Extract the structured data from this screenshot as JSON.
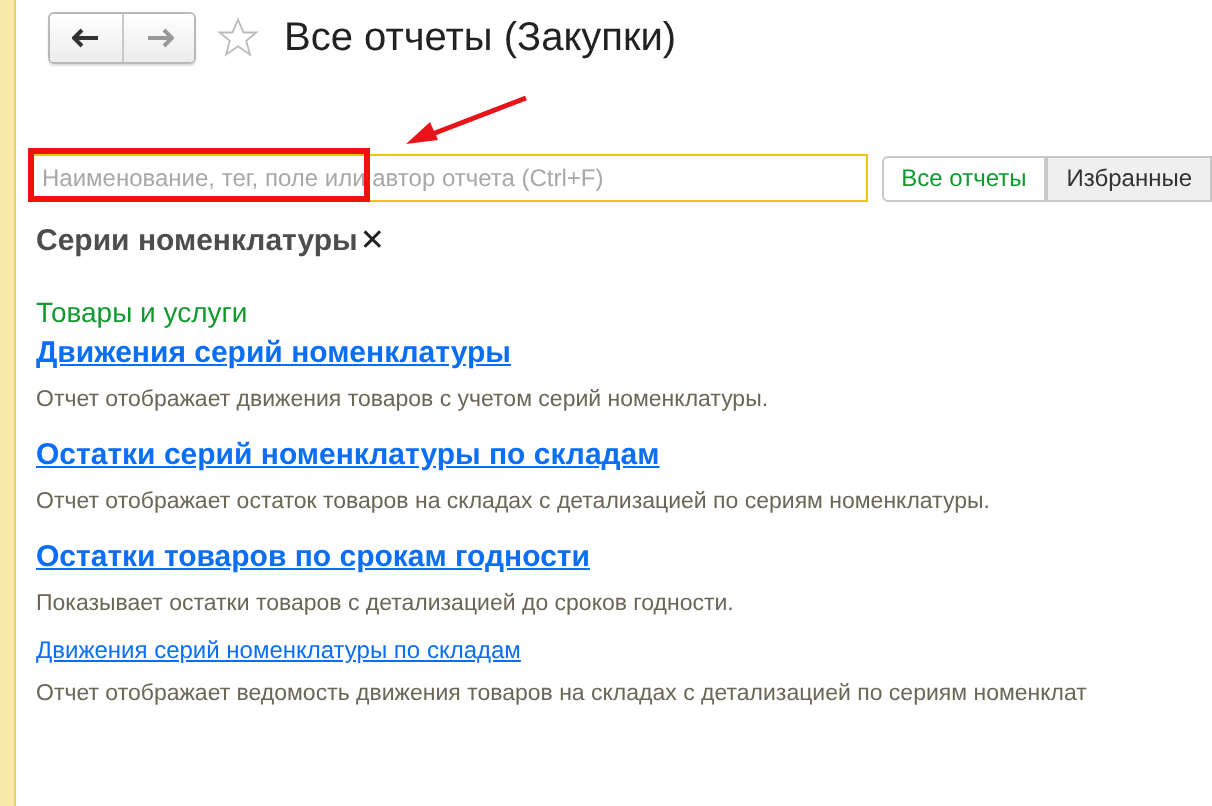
{
  "window": {
    "title": "Все отчеты (Закупки)",
    "favorite": false
  },
  "search": {
    "placeholder": "Наименование, тег, поле или автор отчета (Ctrl+F)"
  },
  "tabs": [
    {
      "label": "Все отчеты",
      "selected": true
    },
    {
      "label": "Избранные",
      "selected": false
    }
  ],
  "filter": {
    "label": "Серии номенклатуры",
    "remove": "✕"
  },
  "section": {
    "title": "Товары и услуги",
    "reports": [
      {
        "kind": "important",
        "title": "Движения серий номенклатуры",
        "description": "Отчет отображает движения товаров с учетом серий номенклатуры."
      },
      {
        "kind": "important",
        "title": "Остатки серий номенклатуры по складам",
        "description": "Отчет отображает остаток товаров на складах с детализацией по сериям номенклатуры."
      },
      {
        "kind": "important",
        "title": "Остатки товаров по срокам годности",
        "description": "Показывает остатки товаров с детализацией до сроков годности."
      },
      {
        "kind": "normal",
        "title": "Движения серий номенклатуры по складам",
        "description": "Отчет отображает ведомость движения товаров на складах с детализацией по сериям номенклат"
      }
    ]
  }
}
